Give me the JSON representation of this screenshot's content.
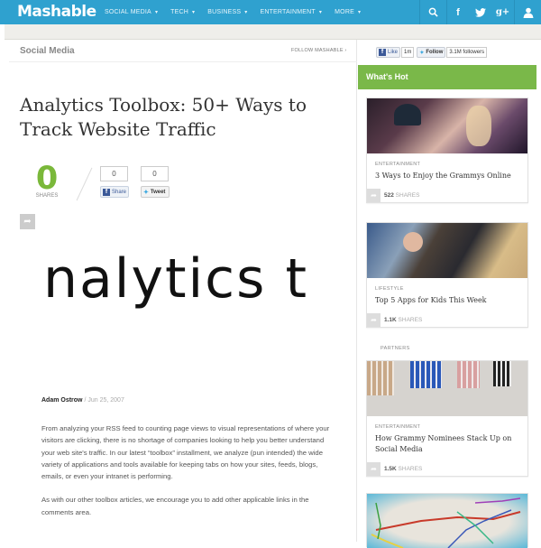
{
  "header": {
    "logo": "Mashable",
    "nav": [
      {
        "label": "SOCIAL MEDIA",
        "caret": "▾"
      },
      {
        "label": "TECH",
        "caret": "▾"
      },
      {
        "label": "BUSINESS",
        "caret": "▾"
      },
      {
        "label": "ENTERTAINMENT",
        "caret": "▾"
      },
      {
        "label": "MORE",
        "caret": "▾"
      }
    ],
    "icons": {
      "search": "⚲",
      "facebook": "f",
      "twitter": "✦",
      "googleplus": "g+",
      "user": "👤"
    }
  },
  "article": {
    "section": "Social Media",
    "follow_label": "FOLLOW MASHABLE ›",
    "title": "Analytics Toolbox: 50+ Ways to Track Website Traffic",
    "shares": {
      "total": "0",
      "label": "SHARES",
      "facebook_count": "0",
      "twitter_count": "0",
      "facebook_button": "Share",
      "twitter_button": "Tweet"
    },
    "share_icon": "➦",
    "hero_text": "nalytics t",
    "author": "Adam Ostrow",
    "date_sep": " / ",
    "date": "Jun 25, 2007",
    "paragraphs": [
      "From analyzing your RSS feed to counting page views to visual representations of where your visitors are clicking, there is no shortage of companies looking to help you better understand your web site's traffic. In our latest “toolbox” installment, we analyze (pun intended) the wide variety of applications and tools available for keeping tabs on how your sites, feeds, blogs, emails, or even your intranet is performing.",
      "As with our other toolbox articles, we encourage you to add other applicable links in the comments area."
    ]
  },
  "sidebar": {
    "social": {
      "like_label": "Like",
      "like_count": "1m",
      "follow_label": "Follow",
      "followers": "3.1M followers"
    },
    "whats_hot": "What's Hot",
    "partners_label": "PARTNERS",
    "cards": [
      {
        "channel": "ENTERTAINMENT",
        "title": "3 Ways to Enjoy the Grammys Online",
        "shares": "522",
        "shares_label": "SHARES"
      },
      {
        "channel": "LIFESTYLE",
        "title": "Top 5 Apps for Kids This Week",
        "shares": "1.1K",
        "shares_label": "SHARES"
      },
      {
        "channel": "ENTERTAINMENT",
        "title": "How Grammy Nominees Stack Up on Social Media",
        "shares": "1.5K",
        "shares_label": "SHARES"
      }
    ]
  },
  "colors": {
    "brand_blue": "#2fa1cf",
    "hot_green": "#7ab849",
    "share_green": "#7ab83a"
  }
}
